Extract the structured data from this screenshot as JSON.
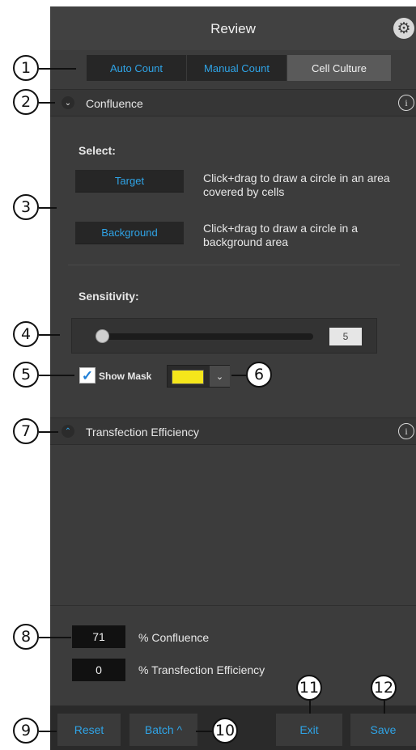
{
  "header": {
    "title": "Review",
    "settings_icon": "gear-icon"
  },
  "tabs": [
    {
      "label": "Auto Count",
      "selected": false
    },
    {
      "label": "Manual Count",
      "selected": false
    },
    {
      "label": "Cell Culture",
      "selected": true
    }
  ],
  "confluence": {
    "section_label": "Confluence",
    "expanded": true,
    "select_label": "Select:",
    "target_button": "Target",
    "target_hint": "Click+drag to draw a circle in an area covered by cells",
    "background_button": "Background",
    "background_hint": "Click+drag to draw a circle in a background area",
    "sensitivity_label": "Sensitivity:",
    "sensitivity_value": "5",
    "show_mask_label": "Show Mask",
    "show_mask_checked": true,
    "mask_color": "#f5e61b"
  },
  "transfection": {
    "section_label": "Transfection Efficiency",
    "expanded": false
  },
  "results": {
    "confluence_value": "71",
    "confluence_label": "% Confluence",
    "transfection_value": "0",
    "transfection_label": "% Transfection Efficiency"
  },
  "footer": {
    "reset": "Reset",
    "batch": "Batch ^",
    "exit": "Exit",
    "save": "Save"
  },
  "callouts": [
    "1",
    "2",
    "3",
    "4",
    "5",
    "6",
    "7",
    "8",
    "9",
    "10",
    "11",
    "12"
  ],
  "colors": {
    "accent": "#2fa4e7",
    "panel": "#3c3c3c",
    "mask": "#f5e61b"
  }
}
